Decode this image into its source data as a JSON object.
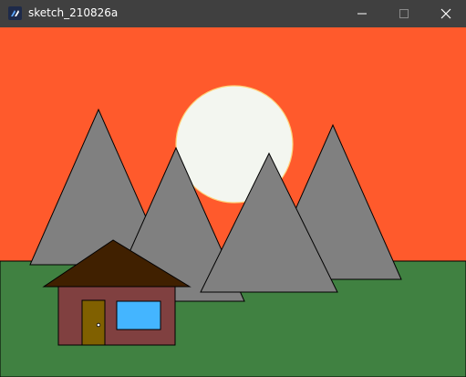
{
  "window": {
    "title": "sketch_210826a",
    "icon": "processing-app-icon"
  },
  "titlebar_buttons": [
    {
      "name": "minimize",
      "icon": "minimize-icon"
    },
    {
      "name": "maximize",
      "icon": "maximize-icon"
    },
    {
      "name": "close",
      "icon": "close-icon"
    }
  ],
  "colors": {
    "titlebar": "#404040",
    "sky": "#ff5a2c",
    "ground": "#408141",
    "sun": "#f3f6f0",
    "sun_outline": "#ffd37a",
    "mountain": "#808080",
    "roof": "#402000",
    "house_wall": "#804040",
    "door": "#806000",
    "window": "#44b5ff"
  }
}
